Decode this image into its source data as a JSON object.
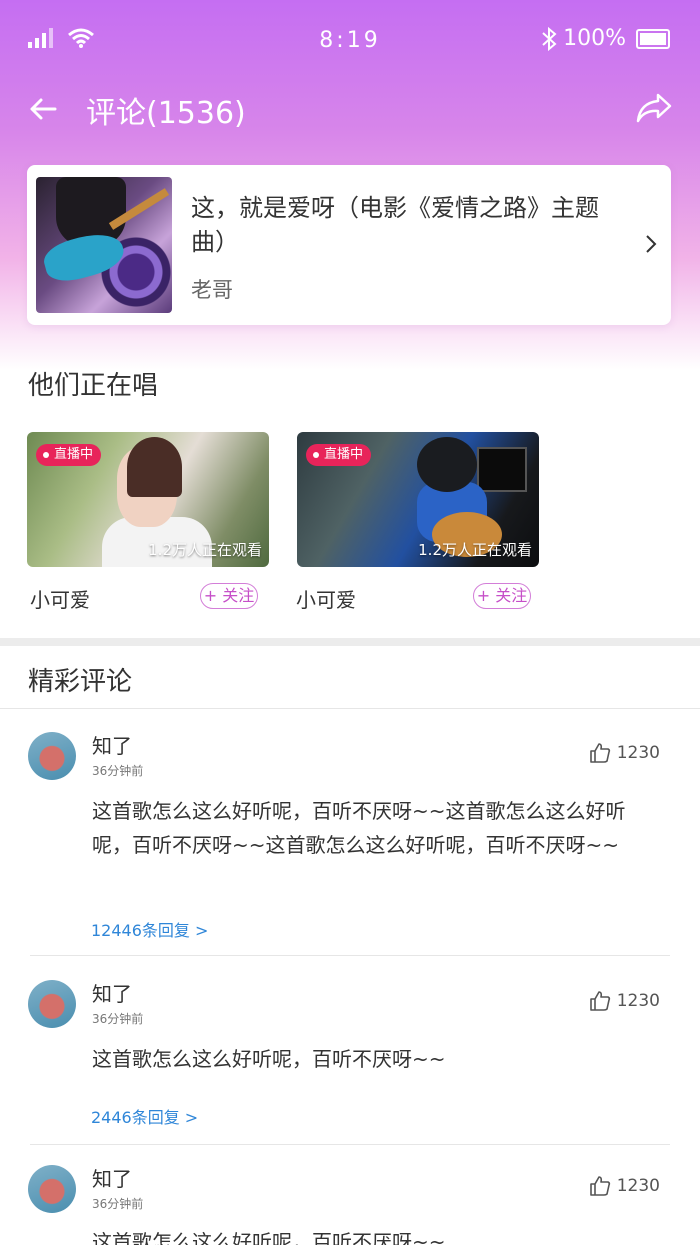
{
  "status_bar": {
    "time": "8:19",
    "battery": "100%"
  },
  "nav": {
    "title": "评论(1536)"
  },
  "song": {
    "title": "这，就是爱呀（电影《爱情之路》主题曲）",
    "artist": "老哥"
  },
  "live_section": {
    "title": "他们正在唱",
    "items": [
      {
        "badge": "直播中",
        "viewers": "1.2万人正在观看",
        "name": "小可爱",
        "follow": "+ 关注"
      },
      {
        "badge": "直播中",
        "viewers": "1.2万人正在观看",
        "name": "小可爱",
        "follow": "+ 关注"
      }
    ]
  },
  "comments_section": {
    "title": "精彩评论",
    "items": [
      {
        "name": "知了",
        "time": "36分钟前",
        "likes": "1230",
        "text": "这首歌怎么这么好听呢，百听不厌呀~~这首歌怎么这么好听呢，百听不厌呀~~这首歌怎么这么好听呢，百听不厌呀~~",
        "replies": "12446条回复  >"
      },
      {
        "name": "知了",
        "time": "36分钟前",
        "likes": "1230",
        "text": "这首歌怎么这么好听呢，百听不厌呀~~",
        "replies": "2446条回复  >"
      },
      {
        "name": "知了",
        "time": "36分钟前",
        "likes": "1230",
        "text": "这首歌怎么这么好听呢，百听不厌呀~~",
        "replies": ""
      }
    ]
  }
}
